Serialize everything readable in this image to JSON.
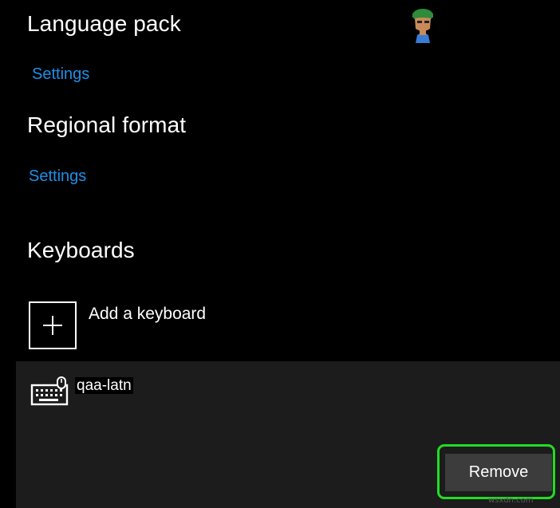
{
  "language_pack": {
    "title": "Language pack",
    "settings_link": "Settings"
  },
  "regional_format": {
    "title": "Regional format",
    "settings_link": "Settings"
  },
  "keyboards": {
    "title": "Keyboards",
    "add_label": "Add a keyboard",
    "items": [
      {
        "name": "qaa-latn",
        "icon": "keyboard-icon"
      }
    ],
    "remove_label": "Remove"
  },
  "colors": {
    "background": "#000000",
    "panel": "#1c1c1c",
    "link": "#1f8fe8",
    "button": "#3c3c3c",
    "highlight": "#22dd22"
  },
  "logo": {
    "icon": "appuals-mascot-logo"
  },
  "watermark": {
    "text": "wsxdn.com"
  }
}
